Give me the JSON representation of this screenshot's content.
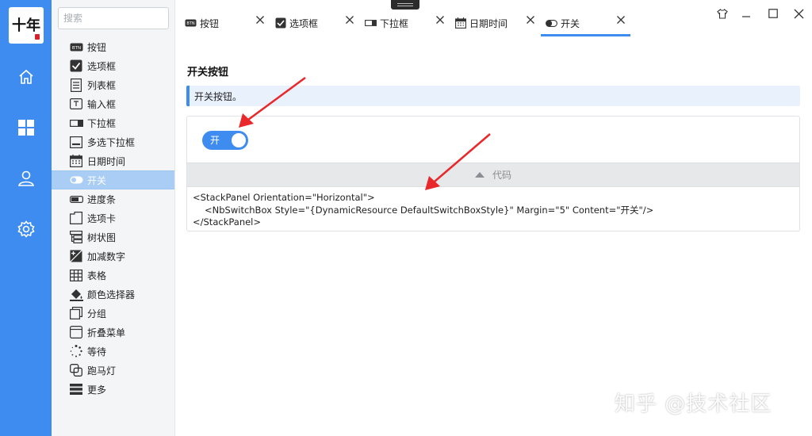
{
  "logo": {
    "glyph": "十年"
  },
  "rail": {
    "items": [
      "home-icon",
      "dashboard-icon",
      "user-icon",
      "settings-icon"
    ]
  },
  "search": {
    "placeholder": "搜索",
    "value": ""
  },
  "nav": {
    "items": [
      {
        "label": "按钮",
        "icon": "button-icon"
      },
      {
        "label": "选项框",
        "icon": "checkbox-icon"
      },
      {
        "label": "列表框",
        "icon": "listbox-icon"
      },
      {
        "label": "输入框",
        "icon": "textbox-icon"
      },
      {
        "label": "下拉框",
        "icon": "combobox-icon"
      },
      {
        "label": "多选下拉框",
        "icon": "multi-combobox-icon"
      },
      {
        "label": "日期时间",
        "icon": "calendar-icon"
      },
      {
        "label": "开关",
        "icon": "switch-icon",
        "active": true
      },
      {
        "label": "进度条",
        "icon": "progress-icon"
      },
      {
        "label": "选项卡",
        "icon": "tab-icon"
      },
      {
        "label": "树状图",
        "icon": "tree-icon"
      },
      {
        "label": "加减数字",
        "icon": "numeric-icon"
      },
      {
        "label": "表格",
        "icon": "table-icon"
      },
      {
        "label": "颜色选择器",
        "icon": "color-picker-icon"
      },
      {
        "label": "分组",
        "icon": "group-icon"
      },
      {
        "label": "折叠菜单",
        "icon": "accordion-icon"
      },
      {
        "label": "等待",
        "icon": "loading-icon"
      },
      {
        "label": "跑马灯",
        "icon": "marquee-icon"
      },
      {
        "label": "更多",
        "icon": "more-icon"
      }
    ]
  },
  "tabs": [
    {
      "label": "按钮",
      "icon": "button-icon"
    },
    {
      "label": "选项框",
      "icon": "checkbox-icon"
    },
    {
      "label": "下拉框",
      "icon": "combobox-icon"
    },
    {
      "label": "日期时间",
      "icon": "calendar-icon"
    },
    {
      "label": "开关",
      "icon": "switch-icon",
      "active": true
    }
  ],
  "page": {
    "title": "开关按钮",
    "info": "开关按钮。",
    "switch": {
      "label": "开",
      "checked": true
    },
    "code_toggle": "代码",
    "code_lines": [
      "<StackPanel Orientation=\"Horizontal\">",
      "<NbSwitchBox Style=\"{DynamicResource DefaultSwitchBoxStyle}\" Margin=\"5\" Content=\"开关\"/>",
      "</StackPanel>"
    ]
  },
  "watermark": "知乎 @技术社区",
  "colors": {
    "accent": "#3f8cf0",
    "arrow": "#e8282b",
    "nav_active": "#a9cdf4"
  }
}
